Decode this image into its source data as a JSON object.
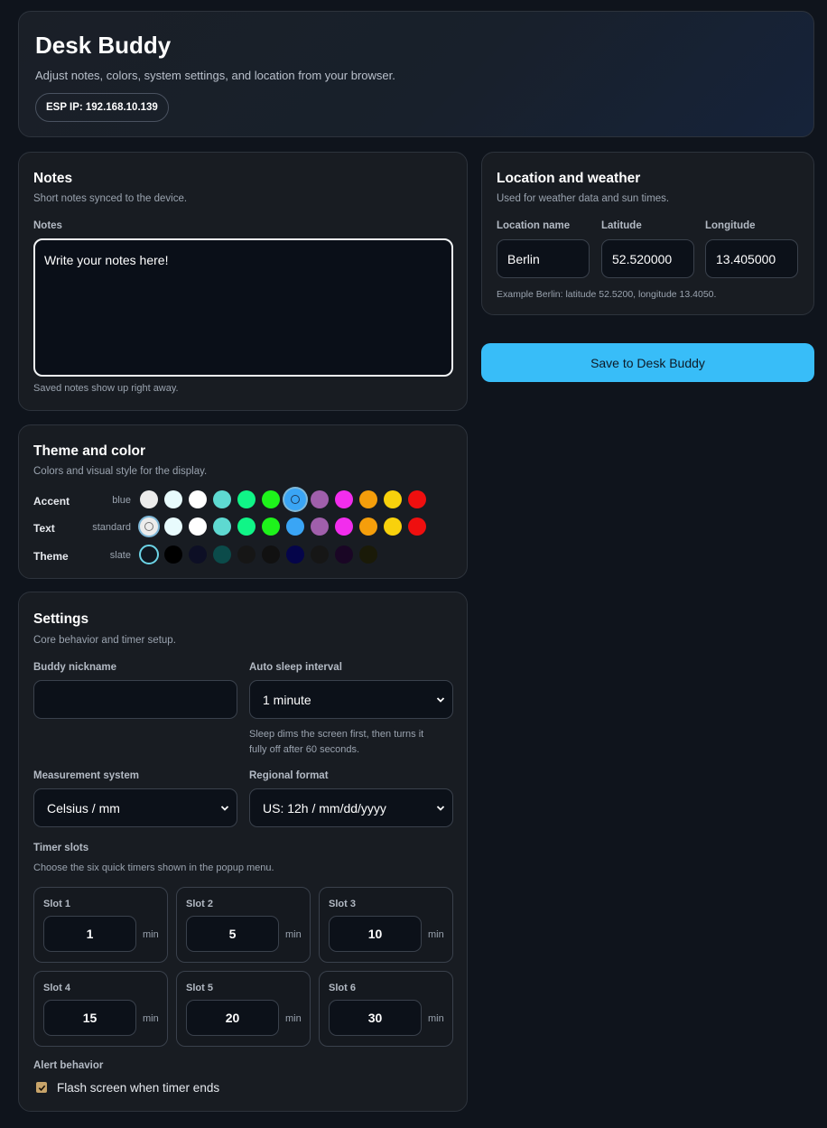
{
  "header": {
    "title": "Desk Buddy",
    "subtitle": "Adjust notes, colors, system settings, and location from your browser.",
    "esp_ip": "ESP IP: 192.168.10.139"
  },
  "notes": {
    "title": "Notes",
    "subtitle": "Short notes synced to the device.",
    "label": "Notes",
    "value": "Write your notes here!",
    "hint": "Saved notes show up right away."
  },
  "location": {
    "title": "Location and weather",
    "subtitle": "Used for weather data and sun times.",
    "name_label": "Location name",
    "name_value": "Berlin",
    "lat_label": "Latitude",
    "lat_value": "52.520000",
    "lon_label": "Longitude",
    "lon_value": "13.405000",
    "hint": "Example Berlin: latitude 52.5200, longitude 13.4050."
  },
  "save_button": "Save to Desk Buddy",
  "theme": {
    "title": "Theme and color",
    "subtitle": "Colors and visual style for the display.",
    "accent": {
      "label": "Accent",
      "value": "blue",
      "selected_index": 6,
      "colors": [
        "#ececec",
        "#e8fbfd",
        "#ffffff",
        "#5ed9d1",
        "#10f587",
        "#1ef31b",
        "#3aa5f5",
        "#a05fab",
        "#f22ded",
        "#f59e0b",
        "#f8d10c",
        "#ef0f0f"
      ]
    },
    "text": {
      "label": "Text",
      "value": "standard",
      "selected_index": 0,
      "colors": [
        "#ececec",
        "#e8fbfd",
        "#ffffff",
        "#5ed9d1",
        "#10f587",
        "#1ef31b",
        "#3aa5f5",
        "#a05fab",
        "#f22ded",
        "#f59e0b",
        "#f8d10c",
        "#ef0f0f"
      ]
    },
    "theme": {
      "label": "Theme",
      "value": "slate",
      "selected_index": 0,
      "colors": [
        "#101820",
        "#000000",
        "#0d0f25",
        "#0b4b4a",
        "#161616",
        "#111111",
        "#05054a",
        "#161616",
        "#1a0625",
        "#1a1a08"
      ]
    }
  },
  "settings": {
    "title": "Settings",
    "subtitle": "Core behavior and timer setup.",
    "nickname_label": "Buddy nickname",
    "nickname_value": "",
    "sleep_label": "Auto sleep interval",
    "sleep_value": "1 minute",
    "sleep_hint_1": "Sleep dims the screen first, then turns it",
    "sleep_hint_2": "fully off after 60 seconds.",
    "measurement_label": "Measurement system",
    "measurement_value": "Celsius / mm",
    "region_label": "Regional format",
    "region_value": "US: 12h / mm/dd/yyyy",
    "timer_label": "Timer slots",
    "timer_hint": "Choose the six quick timers shown in the popup menu.",
    "slots": [
      {
        "label": "Slot 1",
        "value": "1",
        "unit": "min"
      },
      {
        "label": "Slot 2",
        "value": "5",
        "unit": "min"
      },
      {
        "label": "Slot 3",
        "value": "10",
        "unit": "min"
      },
      {
        "label": "Slot 4",
        "value": "15",
        "unit": "min"
      },
      {
        "label": "Slot 5",
        "value": "20",
        "unit": "min"
      },
      {
        "label": "Slot 6",
        "value": "30",
        "unit": "min"
      }
    ],
    "alert_label": "Alert behavior",
    "flash_label": "Flash screen when timer ends",
    "flash_checked": true
  }
}
